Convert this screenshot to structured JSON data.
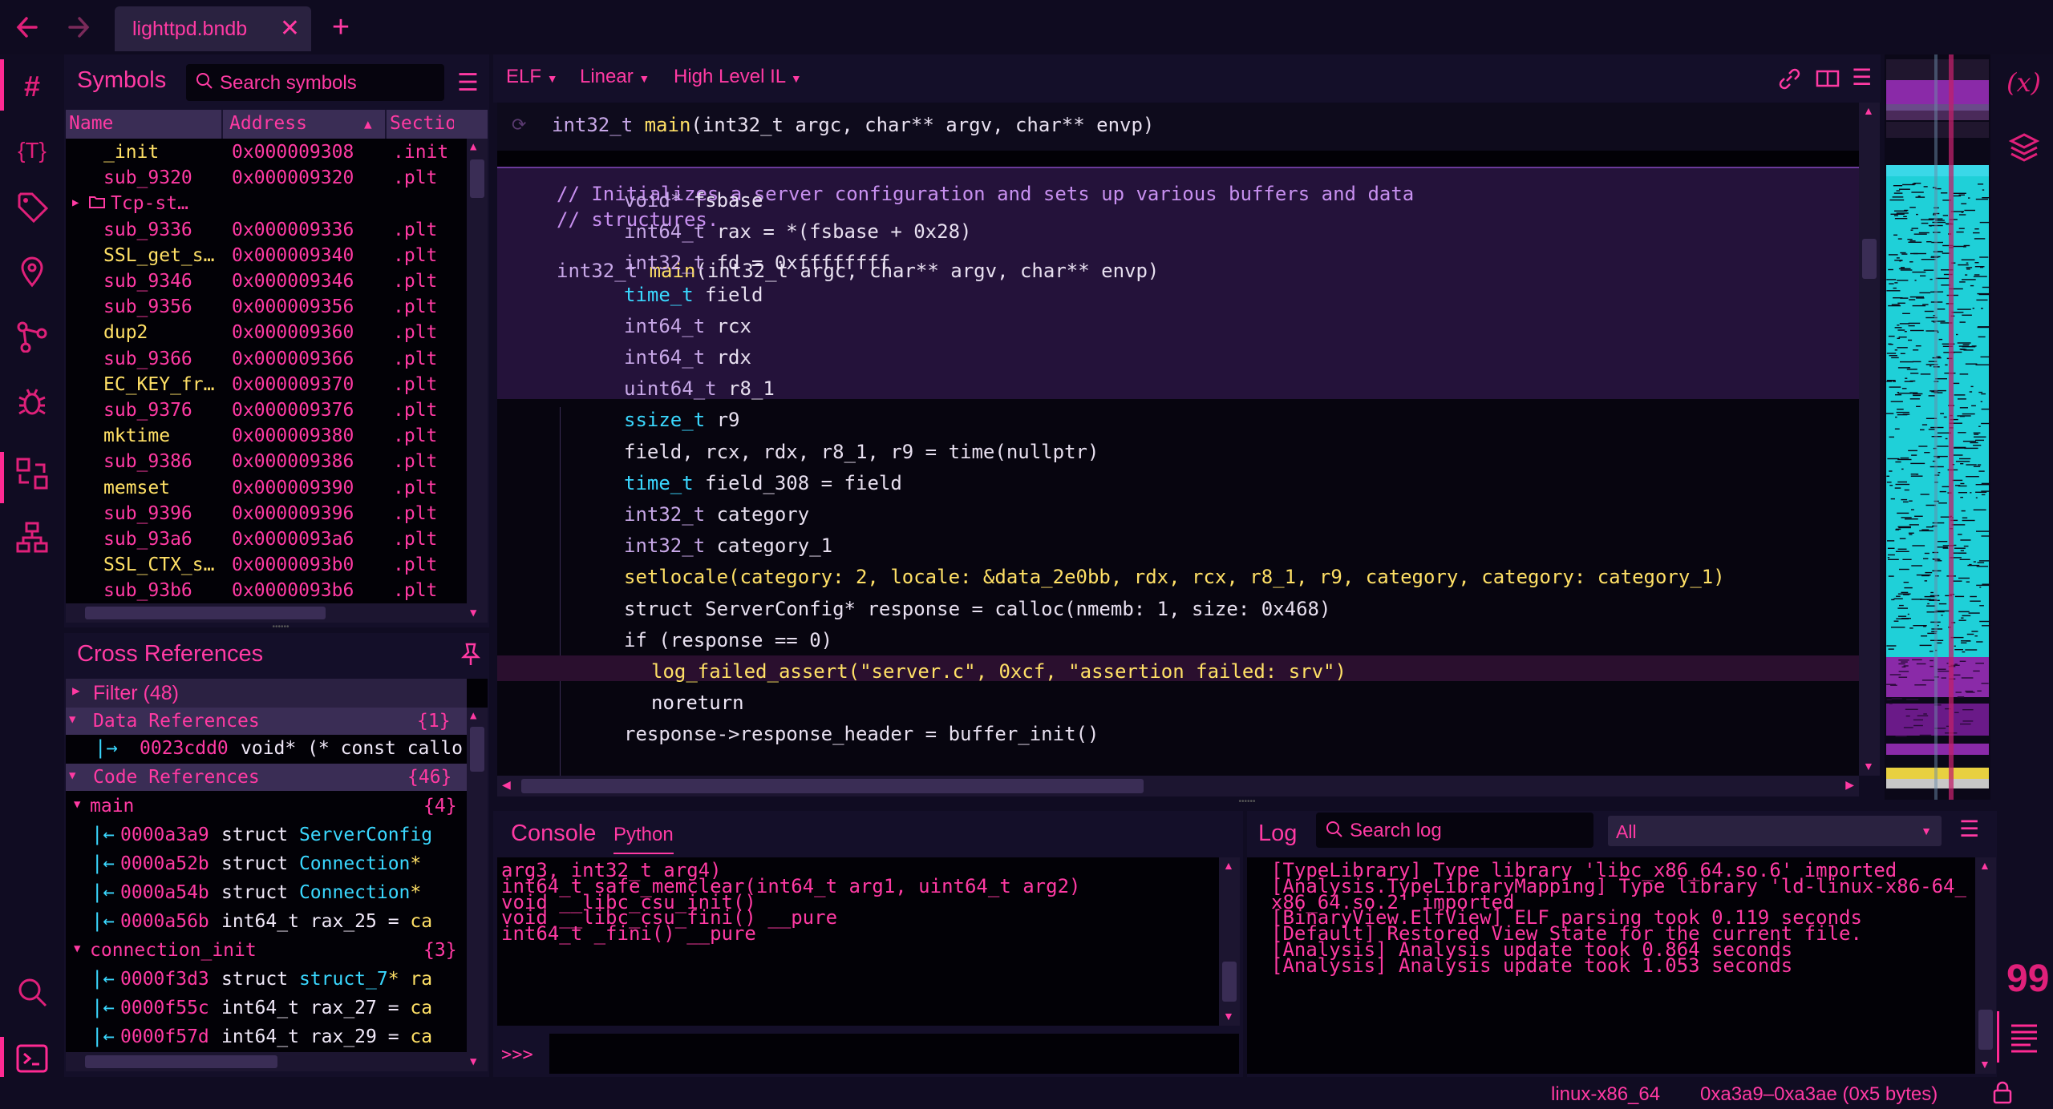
{
  "titlebar": {
    "back_icon": "arrow-left-icon",
    "forward_icon": "arrow-right-icon",
    "tab_label": "lighttpd.bndb",
    "new_tab": "+"
  },
  "symbols": {
    "title": "Symbols",
    "search_placeholder": "Search symbols",
    "columns": [
      "Name",
      "Address",
      "Section"
    ],
    "rows": [
      {
        "name": "_init",
        "address": "0x000009308",
        "section": ".init"
      },
      {
        "name": "sub_9320",
        "address": "0x000009320",
        "section": ".plt"
      },
      {
        "name": "Tcp-st…",
        "address": "",
        "section": ""
      },
      {
        "name": "sub_9336",
        "address": "0x000009336",
        "section": ".plt"
      },
      {
        "name": "SSL_get_s…",
        "address": "0x000009340",
        "section": ".plt"
      },
      {
        "name": "sub_9346",
        "address": "0x000009346",
        "section": ".plt"
      },
      {
        "name": "sub_9356",
        "address": "0x000009356",
        "section": ".plt"
      },
      {
        "name": "dup2",
        "address": "0x000009360",
        "section": ".plt"
      },
      {
        "name": "sub_9366",
        "address": "0x000009366",
        "section": ".plt"
      },
      {
        "name": "EC_KEY_fr…",
        "address": "0x000009370",
        "section": ".plt"
      },
      {
        "name": "sub_9376",
        "address": "0x000009376",
        "section": ".plt"
      },
      {
        "name": "mktime",
        "address": "0x000009380",
        "section": ".plt"
      },
      {
        "name": "sub_9386",
        "address": "0x000009386",
        "section": ".plt"
      },
      {
        "name": "memset",
        "address": "0x000009390",
        "section": ".plt"
      },
      {
        "name": "sub_9396",
        "address": "0x000009396",
        "section": ".plt"
      },
      {
        "name": "sub_93a6",
        "address": "0x0000093a6",
        "section": ".plt"
      },
      {
        "name": "SSL_CTX_s…",
        "address": "0x0000093b0",
        "section": ".plt"
      },
      {
        "name": "sub_93b6",
        "address": "0x0000093b6",
        "section": ".plt"
      }
    ]
  },
  "xrefs": {
    "title": "Cross References",
    "filter": "Filter (48)",
    "data_refs": {
      "label": "Data References",
      "count": "{1}"
    },
    "data_ref_items": [
      {
        "addr": "0023cdd0",
        "text": "void* (* const callo"
      }
    ],
    "code_refs": {
      "label": "Code References",
      "count": "{46}"
    },
    "groups": [
      {
        "name": "main",
        "count": "{4}",
        "items": [
          {
            "addr": "0000a3a9",
            "pre": "struct ",
            "type": "ServerConfig",
            "post": ""
          },
          {
            "addr": "0000a52b",
            "pre": "struct ",
            "type": "Connection",
            "post": "*"
          },
          {
            "addr": "0000a54b",
            "pre": "struct ",
            "type": "Connection",
            "post": "*"
          },
          {
            "addr": "0000a56b",
            "pre": "int64_t rax_25 = ",
            "type": "",
            "post": "ca"
          }
        ]
      },
      {
        "name": "connection_init",
        "count": "{3}",
        "items": [
          {
            "addr": "0000f3d3",
            "pre": "struct ",
            "type": "struct_7",
            "post": "* ra"
          },
          {
            "addr": "0000f55c",
            "pre": "int64_t rax_27 = ",
            "type": "",
            "post": "ca"
          },
          {
            "addr": "0000f57d",
            "pre": "int64_t rax_29 = ",
            "type": "",
            "post": "ca"
          }
        ]
      }
    ]
  },
  "view": {
    "format": "ELF",
    "layout": "Linear",
    "il": "High Level IL"
  },
  "code": {
    "signature": {
      "ret": "int32_t ",
      "name": "main",
      "args": "(int32_t argc, char** argv, char** envp)"
    },
    "comment1": "// Initializes a server configuration and sets up various buffers and data",
    "comment2": "// structures.",
    "decl": {
      "ret": "int32_t ",
      "name": "main",
      "args": "(int32_t argc, char** argv, char** envp)"
    },
    "lines": [
      {
        "t": "void* ",
        "v": "fsbase"
      },
      {
        "t": "int64_t ",
        "v": "rax = *(fsbase + 0x28)"
      },
      {
        "t": "int32_t ",
        "v": "fd = 0xffffffff"
      },
      {
        "t": "time_t ",
        "v": "field"
      },
      {
        "t": "int64_t ",
        "v": "rcx"
      },
      {
        "t": "int64_t ",
        "v": "rdx"
      },
      {
        "t": "uint64_t ",
        "v": "r8_1"
      },
      {
        "t": "ssize_t ",
        "v": "r9"
      },
      {
        "t": "",
        "v": "field, rcx, rdx, r8_1, r9 = time(nullptr)"
      },
      {
        "t": "time_t ",
        "v": "field_308 = field"
      },
      {
        "t": "int32_t ",
        "v": "category"
      },
      {
        "t": "int32_t ",
        "v": "category_1"
      },
      {
        "t": "",
        "v": "setlocale(category: 2, locale: &data_2e0bb, rdx, rcx, r8_1, r9, category, category: category_1)"
      },
      {
        "t": "struct ",
        "v": "ServerConfig* response = calloc(nmemb: 1, size: 0x468)"
      },
      {
        "t": "if ",
        "v": "(response == 0)"
      },
      {
        "t": "",
        "v": "log_failed_assert(\"server.c\", 0xcf, \"assertion failed: srv\")"
      },
      {
        "t": "",
        "v": "noreturn"
      },
      {
        "t": "",
        "v": "response->response_header = buffer_init()"
      }
    ]
  },
  "console": {
    "title": "Console",
    "tab": "Python",
    "lines": [
      "arg3, int32_t arg4)",
      "int64_t safe_memclear(int64_t arg1, uint64_t arg2)",
      "void __libc_csu_init()",
      "void __libc_csu_fini() __pure",
      "int64_t _fini() __pure"
    ],
    "prompt": ">>>"
  },
  "log": {
    "title": "Log",
    "search_placeholder": "Search log",
    "level": "All",
    "lines": [
      "[TypeLibrary] Type library 'libc_x86_64.so.6' imported",
      "[Analysis.TypeLibraryMapping] Type library 'ld-linux-x86-64_",
      "x86_64.so.2' imported",
      "[BinaryView.ElfView] ELF parsing took 0.119 seconds",
      "[Default] Restored View State for the current file.",
      "[Analysis] Analysis update took 0.864 seconds",
      "[Analysis] Analysis update took 1.053 seconds"
    ]
  },
  "status": {
    "platform": "linux-x86_64",
    "selection": "0xa3a9–0xa3ae (0x5 bytes)"
  },
  "colors": {
    "accent": "#ff2a93",
    "yellow": "#ffe066",
    "cyan": "#3ad8ff",
    "bg": "#100c22"
  }
}
